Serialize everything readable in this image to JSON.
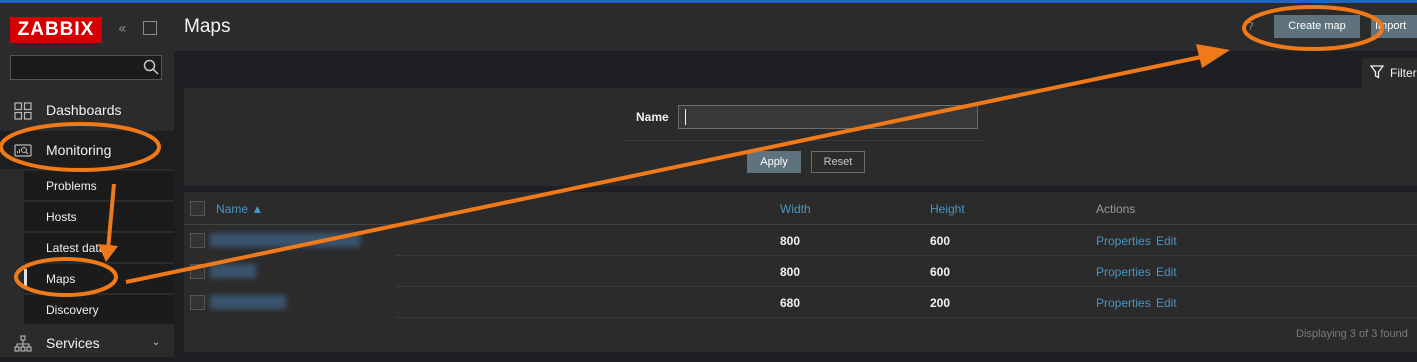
{
  "sidebar": {
    "logo": "ZABBIX",
    "search": {
      "value": "",
      "placeholder": ""
    },
    "nav": [
      {
        "label": "Dashboards",
        "icon": "dashboards-icon"
      },
      {
        "label": "Monitoring",
        "icon": "monitoring-icon"
      },
      {
        "label": "Services",
        "icon": "services-icon"
      }
    ],
    "monitoring_sub": [
      "Problems",
      "Hosts",
      "Latest data",
      "Maps",
      "Discovery"
    ],
    "active_sub": "Maps"
  },
  "header": {
    "title": "Maps",
    "create_label": "Create map",
    "import_label": "Import"
  },
  "filter": {
    "tab_label": "Filter",
    "name_label": "Name",
    "name_value": "",
    "apply_label": "Apply",
    "reset_label": "Reset"
  },
  "table": {
    "columns": {
      "name": "Name ▲",
      "width": "Width",
      "height": "Height",
      "actions": "Actions"
    },
    "rows": [
      {
        "width": "800",
        "height": "600",
        "properties": "Properties",
        "edit": "Edit"
      },
      {
        "width": "800",
        "height": "600",
        "properties": "Properties",
        "edit": "Edit"
      },
      {
        "width": "680",
        "height": "200",
        "properties": "Properties",
        "edit": "Edit"
      }
    ],
    "footer": "Displaying 3 of 3 found"
  },
  "colors": {
    "accent": "#4796c4",
    "brand": "#d40000",
    "annotation": "#f07a1a",
    "button": "#5e737e"
  }
}
